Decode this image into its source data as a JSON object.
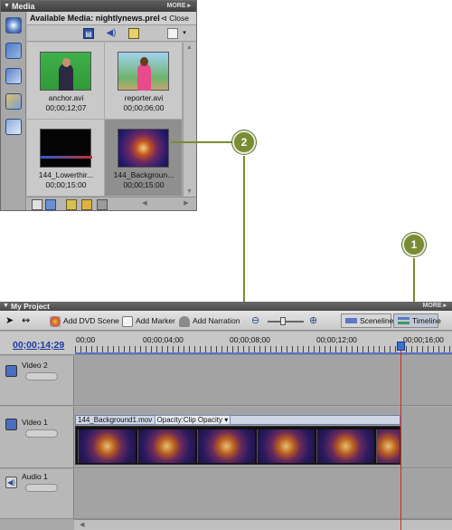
{
  "media_panel": {
    "title": "Media",
    "more_label": "MORE",
    "header_label": "Available Media: nightlynews.prel",
    "close_label": "Close",
    "items": [
      {
        "name": "anchor.avi",
        "duration": "00;00;12;07",
        "selected": false
      },
      {
        "name": "reporter.avi",
        "duration": "00;00;06;00",
        "selected": false
      },
      {
        "name": "144_Lowerthir...",
        "duration": "00;00;15:00",
        "selected": false
      },
      {
        "name": "144_Backgroun...",
        "duration": "00;00;15:00",
        "selected": true
      }
    ]
  },
  "callouts": {
    "one": "1",
    "two": "2"
  },
  "project_panel": {
    "title": "My Project",
    "more_label": "MORE",
    "toolbar": {
      "add_dvd_scene": "Add DVD Scene",
      "add_marker": "Add Marker",
      "add_narration": "Add Narration",
      "sceneline": "Sceneline",
      "timeline": "Timeline"
    },
    "timecode": "00;00;14;29",
    "ruler_labels": [
      "00;00",
      "00;00;04;00",
      "00;00;08;00",
      "00;00;12;00",
      "00;00;16;00"
    ],
    "tracks": [
      {
        "name": "Video 2"
      },
      {
        "name": "Video 1"
      },
      {
        "name": "Audio 1"
      }
    ],
    "clip": {
      "name": "144_Background1.mov",
      "property": "Opacity:Clip Opacity"
    }
  },
  "colors": {
    "callout": "#7a8c33",
    "timecode": "#1a3aa0",
    "playhead_line": "#cc2a2a"
  }
}
